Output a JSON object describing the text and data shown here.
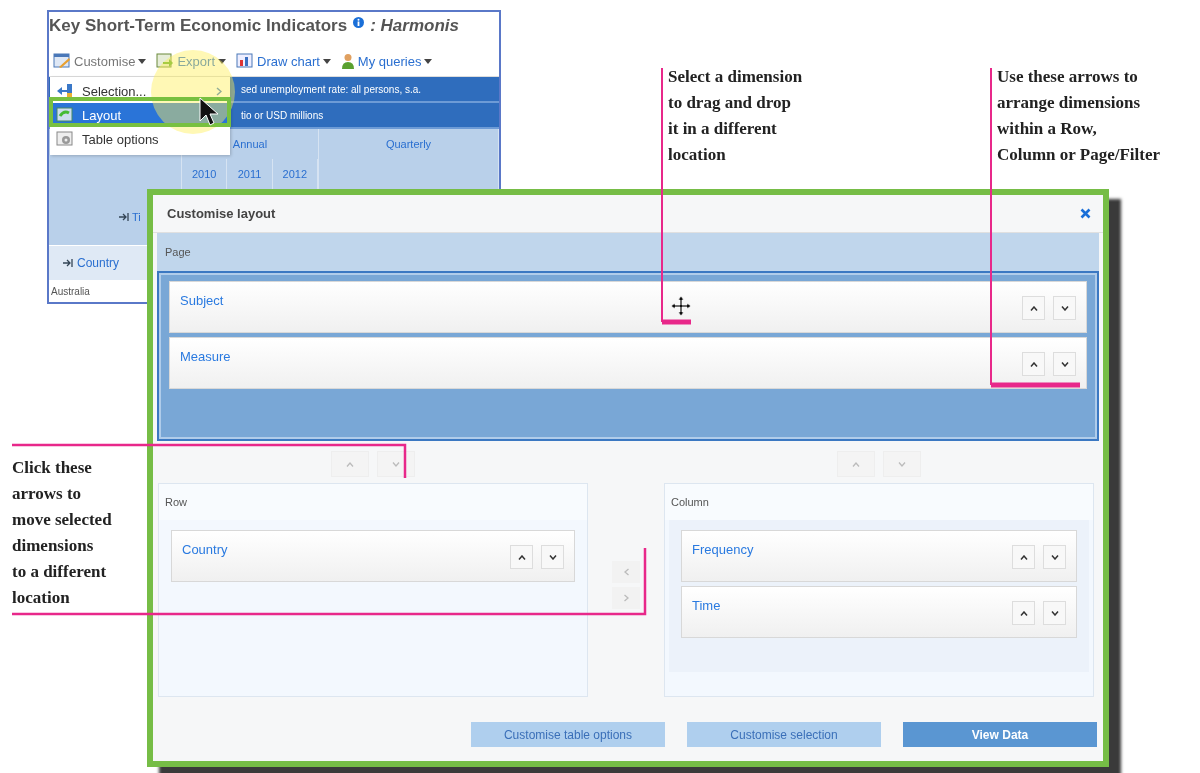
{
  "background_window": {
    "title": "Key Short-Term Economic Indicators",
    "subtitle": ": Harmonis",
    "toolbar": [
      {
        "kind": "customise",
        "label": "Customise"
      },
      {
        "kind": "export",
        "label": "Export"
      },
      {
        "kind": "chart",
        "label": "Draw chart"
      },
      {
        "kind": "queries",
        "label": "My queries"
      }
    ],
    "menu": [
      {
        "label": "Selection...",
        "submenu": true,
        "selected": false
      },
      {
        "label": "Layout",
        "submenu": false,
        "selected": true
      },
      {
        "label": "Table options",
        "submenu": false,
        "selected": false
      }
    ],
    "header_rows": [
      "sed unemployment rate: all persons, s.a.",
      "tio or USD millions"
    ],
    "frequency_headers": [
      "Annual",
      "Quarterly"
    ],
    "years": [
      "2010",
      "2011",
      "2012"
    ],
    "row_dimension": "Ti",
    "country_dimension": "Country",
    "first_row": "Australia"
  },
  "dialog": {
    "title": "Customise layout",
    "page": {
      "label": "Page",
      "items": [
        "Subject",
        "Measure"
      ]
    },
    "row": {
      "label": "Row",
      "items": [
        "Country"
      ]
    },
    "column": {
      "label": "Column",
      "items": [
        "Frequency",
        "Time"
      ]
    },
    "buttons": [
      {
        "label": "Customise table options",
        "primary": false
      },
      {
        "label": "Customise selection",
        "primary": false
      },
      {
        "label": "View Data",
        "primary": true
      }
    ]
  },
  "callouts": [
    {
      "text": "Select a dimension\nto drag and drop\nit in a different\nlocation"
    },
    {
      "text": "Use these arrows to\narrange dimensions\nwithin a Row,\nColumn or Page/Filter"
    },
    {
      "text": "Click these\narrows to\nmove selected\ndimensions\nto a different\nlocation"
    }
  ]
}
